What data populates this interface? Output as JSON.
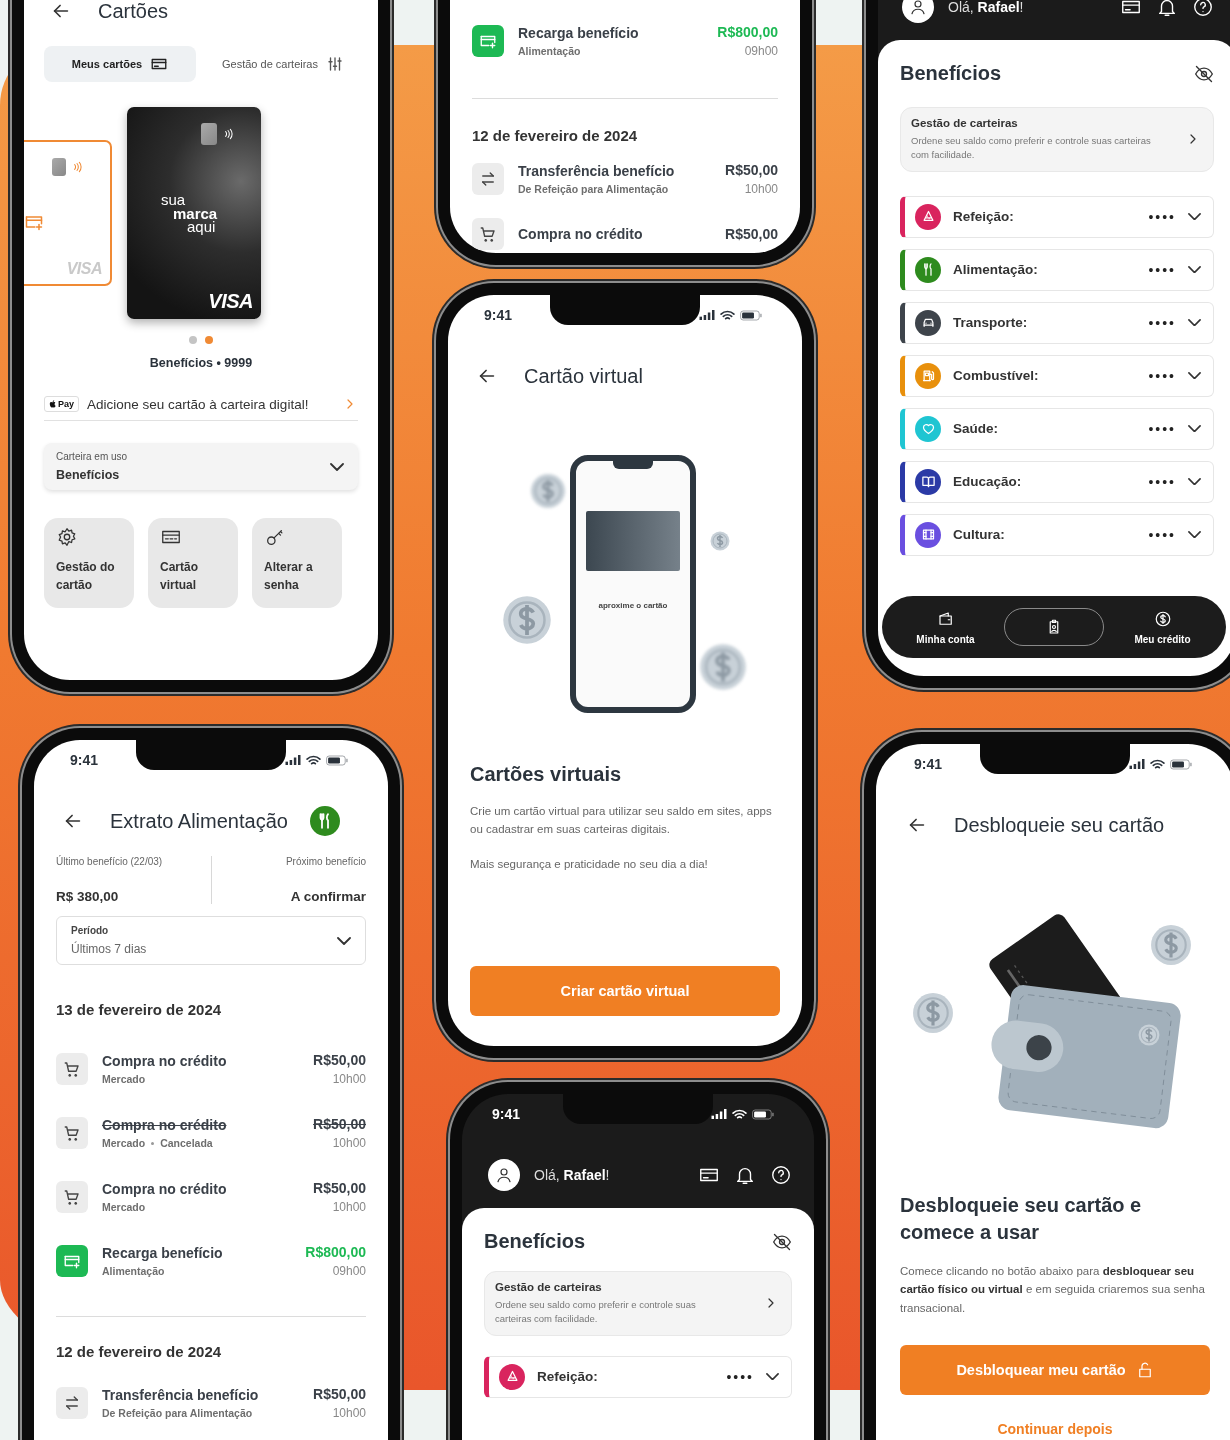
{
  "screens": [
    {
      "kind": "cards",
      "title": "Cartões",
      "tabs": [
        {
          "kind": "cards",
          "label": "Meus cartões",
          "selected": true
        },
        {
          "kind": "sliders",
          "label": "Gestão de carteiras",
          "selected": false
        }
      ],
      "cards": [
        {
          "kind": "virtual",
          "network": "VISA",
          "selected": false
        },
        {
          "kind": "physical",
          "brand_lines": [
            {
              "text": "sua",
              "bold": false
            },
            {
              "text": "marca",
              "bold": true
            },
            {
              "text": "aqui",
              "bold": false
            }
          ],
          "network": "VISA",
          "selected": true
        }
      ],
      "card_label": "Benefícios • 9999",
      "wallet_prompt": {
        "badge": "Pay",
        "text": "Adicione seu cartão à carteira digital!"
      },
      "wallet_select": {
        "label": "Carteira em uso",
        "value": "Benefícios"
      },
      "actions": [
        {
          "kind": "settings",
          "label": "Gestão do cartão"
        },
        {
          "kind": "card",
          "label": "Cartão virtual"
        },
        {
          "kind": "key",
          "label": "Alterar a senha"
        }
      ]
    },
    {
      "kind": "statement_tail",
      "groups": [
        {
          "items": [
            {
              "kind": "recharge",
              "title": "Recarga benefício",
              "subtitle": "Alimentação",
              "amount": "R$800,00",
              "time": "09h00",
              "cancelled": false
            }
          ]
        },
        {
          "date": "12 de fevereiro de 2024",
          "items": [
            {
              "kind": "transfer",
              "title": "Transferência benefício",
              "subtitle": "De Refeição para Alimentação",
              "amount": "R$50,00",
              "time": "10h00",
              "cancelled": false
            },
            {
              "kind": "purchase",
              "title": "Compra no crédito",
              "amount": "R$50,00",
              "cancelled": false
            }
          ]
        }
      ]
    },
    {
      "kind": "home",
      "greeting": "Olá, **Rafael**!",
      "title": "Benefícios",
      "manage": {
        "title": "Gestão de carteiras",
        "text": "Ordene seu saldo como preferir e controle suas carteiras com facilidade."
      },
      "wallets": [
        {
          "kind": "meal",
          "name": "Refeição:",
          "balance": "••••",
          "color": "#d9245e"
        },
        {
          "kind": "food",
          "name": "Alimentação:",
          "balance": "••••",
          "color": "#2e8b1e"
        },
        {
          "kind": "transport",
          "name": "Transporte:",
          "balance": "••••",
          "color": "#3e444b"
        },
        {
          "kind": "fuel",
          "name": "Combustível:",
          "balance": "••••",
          "color": "#e8900c"
        },
        {
          "kind": "health",
          "name": "Saúde:",
          "balance": "••••",
          "color": "#1fc5d2"
        },
        {
          "kind": "education",
          "name": "Educação:",
          "balance": "••••",
          "color": "#2b3aa6"
        },
        {
          "kind": "culture",
          "name": "Cultura:",
          "balance": "••••",
          "color": "#6a4fe0"
        }
      ],
      "nav": [
        {
          "kind": "wallet",
          "label": "Minha conta",
          "selected": false
        },
        {
          "kind": "badge",
          "selected": true
        },
        {
          "kind": "dollar",
          "label": "Meu crédito",
          "selected": false
        }
      ]
    },
    {
      "kind": "statement",
      "time": "9:41",
      "title": "Extrato Alimentação",
      "summary": [
        {
          "label": "Último benefício (22/03)",
          "value": "R$ 380,00"
        },
        {
          "label": "Próximo benefício",
          "value": "A confirmar"
        }
      ],
      "period": {
        "label": "Período",
        "value": "Últimos 7 dias"
      },
      "groups": [
        {
          "date": "13 de fevereiro de 2024",
          "items": [
            {
              "kind": "purchase",
              "title": "Compra no crédito",
              "subtitle": "Mercado",
              "amount": "R$50,00",
              "time": "10h00",
              "cancelled": false
            },
            {
              "kind": "purchase",
              "title": "Compra no crédito",
              "subtitle": "Mercado",
              "status": "Cancelada",
              "amount": "R$50,00",
              "time": "10h00",
              "cancelled": true
            },
            {
              "kind": "purchase",
              "title": "Compra no crédito",
              "subtitle": "Mercado",
              "amount": "R$50,00",
              "time": "10h00",
              "cancelled": false
            },
            {
              "kind": "recharge",
              "title": "Recarga benefício",
              "subtitle": "Alimentação",
              "amount": "R$800,00",
              "time": "09h00",
              "cancelled": false
            }
          ]
        },
        {
          "date": "12 de fevereiro de 2024",
          "items": [
            {
              "kind": "transfer",
              "title": "Transferência benefício",
              "subtitle": "De Refeição para Alimentação",
              "amount": "R$50,00",
              "time": "10h00",
              "cancelled": false
            }
          ]
        }
      ]
    },
    {
      "kind": "virtual_card",
      "time": "9:41",
      "title": "Cartão virtual",
      "illustration_caption": "aproxime o cartão",
      "heading": "Cartões virtuais",
      "paragraphs": [
        "Crie um cartão virtual para utilizar seu saldo em sites, apps ou cadastrar em suas carteiras digitais.",
        "Mais segurança e praticidade no seu dia a dia!"
      ],
      "button": "Criar cartão virtual"
    },
    {
      "kind": "home",
      "time": "9:41",
      "greeting": "Olá, **Rafael**!",
      "title": "Benefícios",
      "manage": {
        "title": "Gestão de carteiras",
        "text": "Ordene seu saldo como preferir e controle suas carteiras com facilidade."
      },
      "wallets": [
        {
          "kind": "meal",
          "name": "Refeição:",
          "balance": "••••",
          "color": "#d9245e"
        }
      ]
    },
    {
      "kind": "unlock",
      "time": "9:41",
      "title": "Desbloqueie seu cartão",
      "heading": "Desbloqueie seu cartão e comece a usar",
      "text": "Comece clicando no botão abaixo para **desbloquear seu cartão físico ou virtual** e em seguida criaremos sua senha transacional.",
      "button": "Desbloquear meu cartão",
      "link": "Continuar depois"
    }
  ]
}
